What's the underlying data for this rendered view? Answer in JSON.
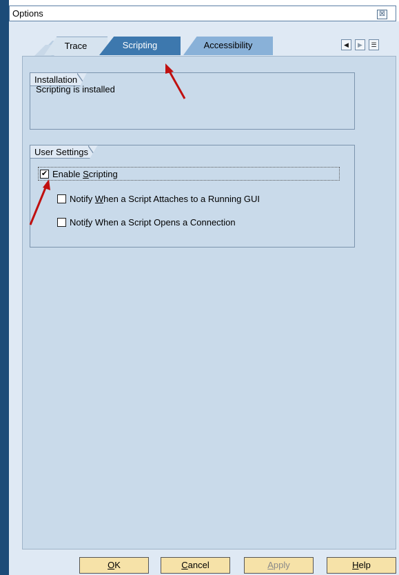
{
  "window": {
    "title": "Options",
    "close_glyph": "☒"
  },
  "tabs": [
    {
      "label": "Trace",
      "active": false
    },
    {
      "label": "Scripting",
      "active": true
    },
    {
      "label": "Accessibility",
      "active": false
    }
  ],
  "tab_nav": {
    "left_glyph": "◀",
    "right_glyph": "▶",
    "list_glyph": "☰"
  },
  "installation": {
    "legend": "Installation",
    "status_text": "Scripting is installed"
  },
  "user_settings": {
    "legend": "User Settings",
    "enable_scripting": {
      "pre": "Enable ",
      "mnemonic": "S",
      "post": "cripting",
      "checked": true
    },
    "notify_attach": {
      "pre": "Notify ",
      "mnemonic": "W",
      "post": "hen a Script Attaches to a Running GUI",
      "checked": false
    },
    "notify_open": {
      "pre": "Noti",
      "mnemonic": "f",
      "post": "y When a Script Opens a Connection",
      "checked": false
    }
  },
  "buttons": {
    "ok": {
      "mnemonic": "O",
      "post": "K"
    },
    "cancel": {
      "mnemonic": "C",
      "post": "ancel"
    },
    "apply": {
      "mnemonic": "A",
      "post": "pply",
      "disabled": true
    },
    "help": {
      "mnemonic": "H",
      "post": "elp"
    }
  },
  "check_glyph": "✔",
  "colors": {
    "accent_tab": "#3d78ae",
    "panel": "#c9daea",
    "button": "#f6e2a8",
    "arrow": "#c01010"
  }
}
